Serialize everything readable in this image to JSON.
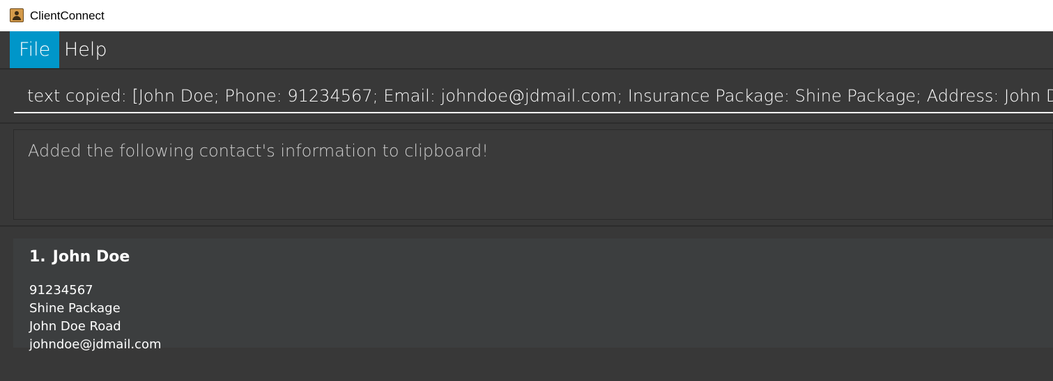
{
  "window": {
    "title": "ClientConnect",
    "icon": "address-book-icon"
  },
  "menu": {
    "items": [
      {
        "label": "File",
        "active": true
      },
      {
        "label": "Help",
        "active": false
      }
    ]
  },
  "command_box": {
    "value": "text copied: [John Doe; Phone: 91234567; Email: johndoe@jdmail.com; Insurance Package: Shine Package; Address: John Doe Road]"
  },
  "result_display": {
    "message": "Added the following contact's information to clipboard!"
  },
  "person_list": {
    "cards": [
      {
        "index": "1.",
        "name": "John Doe",
        "phone": "91234567",
        "insurance_package": "Shine Package",
        "address": "John Doe Road",
        "email": "johndoe@jdmail.com"
      }
    ]
  },
  "colors": {
    "background": "#383838",
    "menu_active": "#0096c9",
    "card_background": "#3c3e3f",
    "text": "#ffffff"
  }
}
